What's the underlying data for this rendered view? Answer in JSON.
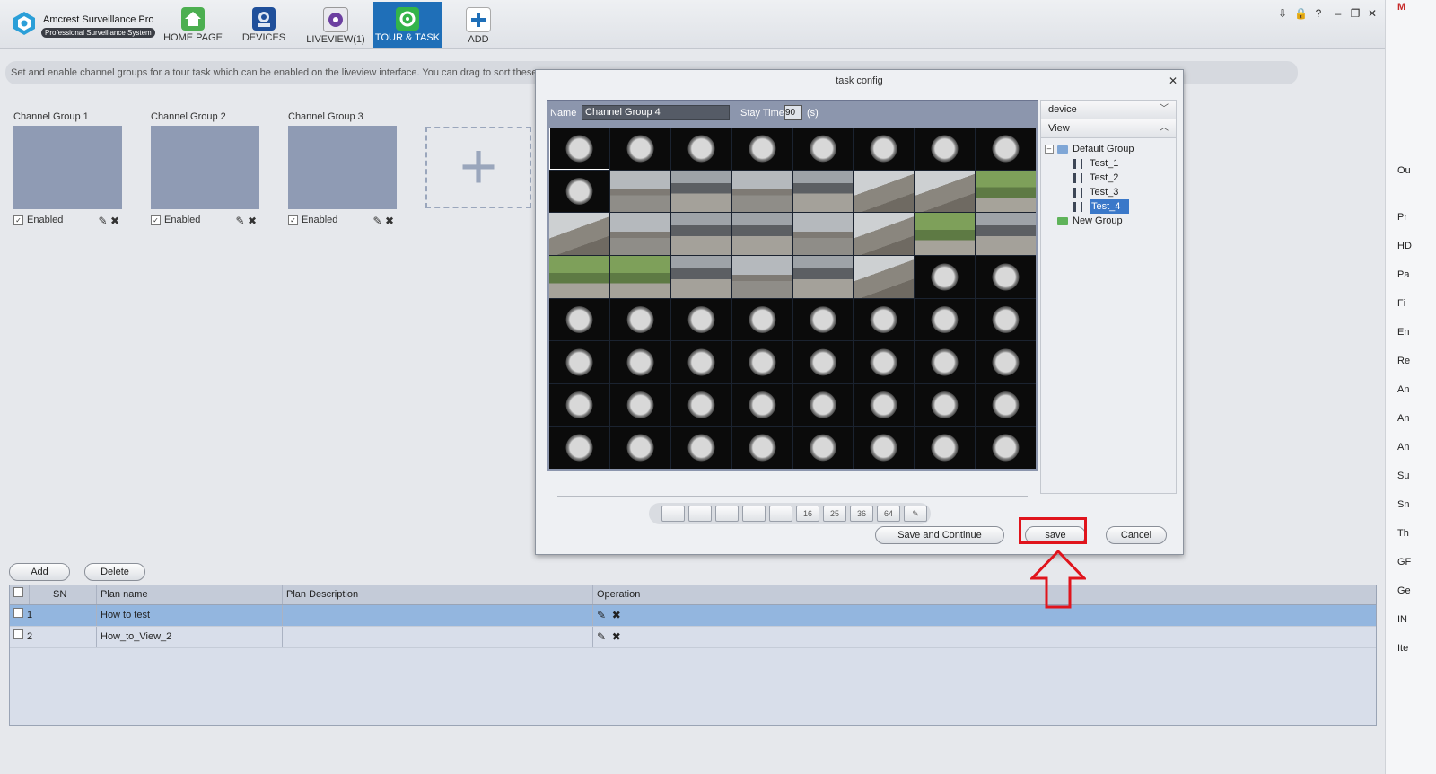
{
  "app": {
    "brand_name": "Amcrest Surveillance Pro",
    "brand_tag": "Professional Surveillance System"
  },
  "nav": [
    {
      "label": "HOME PAGE",
      "icon": "home-icon",
      "color": "#4caf50"
    },
    {
      "label": "DEVICES",
      "icon": "camera-icon",
      "color": "#1f4f9a"
    },
    {
      "label": "LIVEVIEW(1)",
      "icon": "liveview-icon",
      "color": "#6c3fa0"
    },
    {
      "label": "TOUR & TASK",
      "icon": "tour-task-icon",
      "color": "#33b44a",
      "active": true
    },
    {
      "label": "ADD",
      "icon": "add-icon",
      "color": "#1f6fb8"
    }
  ],
  "window_controls": [
    "⇩",
    "🔒",
    "?",
    "–",
    "❐",
    "✕"
  ],
  "info_text": "Set and enable channel groups for a tour task which can be enabled on the liveview interface. You can drag to sort these group",
  "groups": [
    {
      "title": "Channel Group 1",
      "enabled_label": "Enabled",
      "layout": "grid9"
    },
    {
      "title": "Channel Group 2",
      "enabled_label": "Enabled",
      "layout": "grid9"
    },
    {
      "title": "Channel Group 3",
      "enabled_label": "Enabled",
      "layout": "single"
    }
  ],
  "add_group_glyph": "+",
  "plan_buttons": {
    "add": "Add",
    "delete": "Delete"
  },
  "plan_table": {
    "headers": [
      "SN",
      "Plan name",
      "Plan Description",
      "Operation"
    ],
    "rows": [
      {
        "sn": "1",
        "name": "How to test",
        "description": "",
        "selected": true
      },
      {
        "sn": "2",
        "name": "How_to_View_2",
        "description": "",
        "selected": false
      }
    ]
  },
  "dialog": {
    "title": "task config",
    "name_label": "Name",
    "name_value": "Channel Group 4",
    "stay_label": "Stay Time",
    "stay_value": "90",
    "stay_unit": "(s)",
    "device_dropdown": "device",
    "view_dropdown": "View",
    "tree": {
      "root": "Default Group",
      "children": [
        "Test_1",
        "Test_2",
        "Test_3",
        "Test_4"
      ],
      "selected": "Test_4",
      "new_group": "New Group"
    },
    "layouts": [
      "",
      "",
      "",
      "",
      "",
      "16",
      "25",
      "36",
      "64",
      "✎"
    ],
    "buttons": {
      "save_continue": "Save and Continue",
      "save": "save",
      "cancel": "Cancel"
    }
  },
  "annotation_color": "#e0141c",
  "browser_strip": [
    "M",
    "Ou",
    "Pr",
    "HD",
    "Pa",
    "Fi",
    "En",
    "Re",
    "An",
    "An",
    "An",
    "Su",
    "Sn",
    "Th",
    "GF",
    "Ge",
    "IN",
    "Ite"
  ]
}
